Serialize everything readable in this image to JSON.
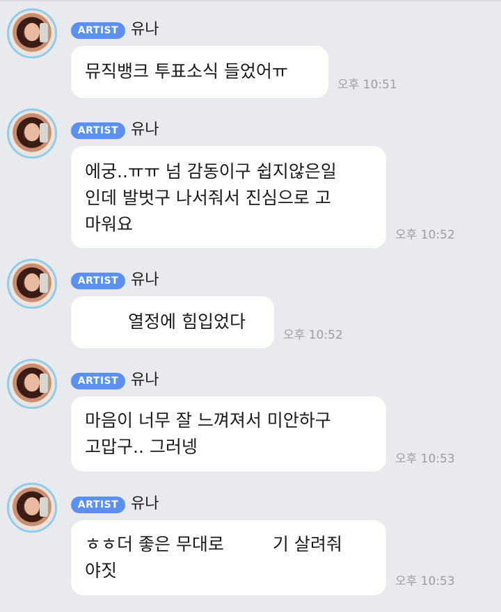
{
  "messages": [
    {
      "badge": "ARTIST",
      "sender": "유나",
      "text": "뮤직뱅크 투표소식 들었어ㅠ",
      "time": "오후 10:51"
    },
    {
      "badge": "ARTIST",
      "sender": "유나",
      "text": "에궁..ㅠㅠ 넘 감동이구 쉽지않은일\n인데 발벗구 나서줘서 진심으로 고\n마워요",
      "time": "오후 10:52"
    },
    {
      "badge": "ARTIST",
      "sender": "유나",
      "text": "열정에 힘입었다",
      "time": "오후 10:52"
    },
    {
      "badge": "ARTIST",
      "sender": "유나",
      "text": "마음이 너무 잘 느껴져서 미안하구\n고맙구.. 그러넹",
      "time": "오후 10:53"
    },
    {
      "badge": "ARTIST",
      "sender": "유나",
      "text_a": "ㅎㅎ더 좋은 무대로",
      "text_b": "기 살려줘\n야짓",
      "time": "오후 10:53"
    }
  ]
}
